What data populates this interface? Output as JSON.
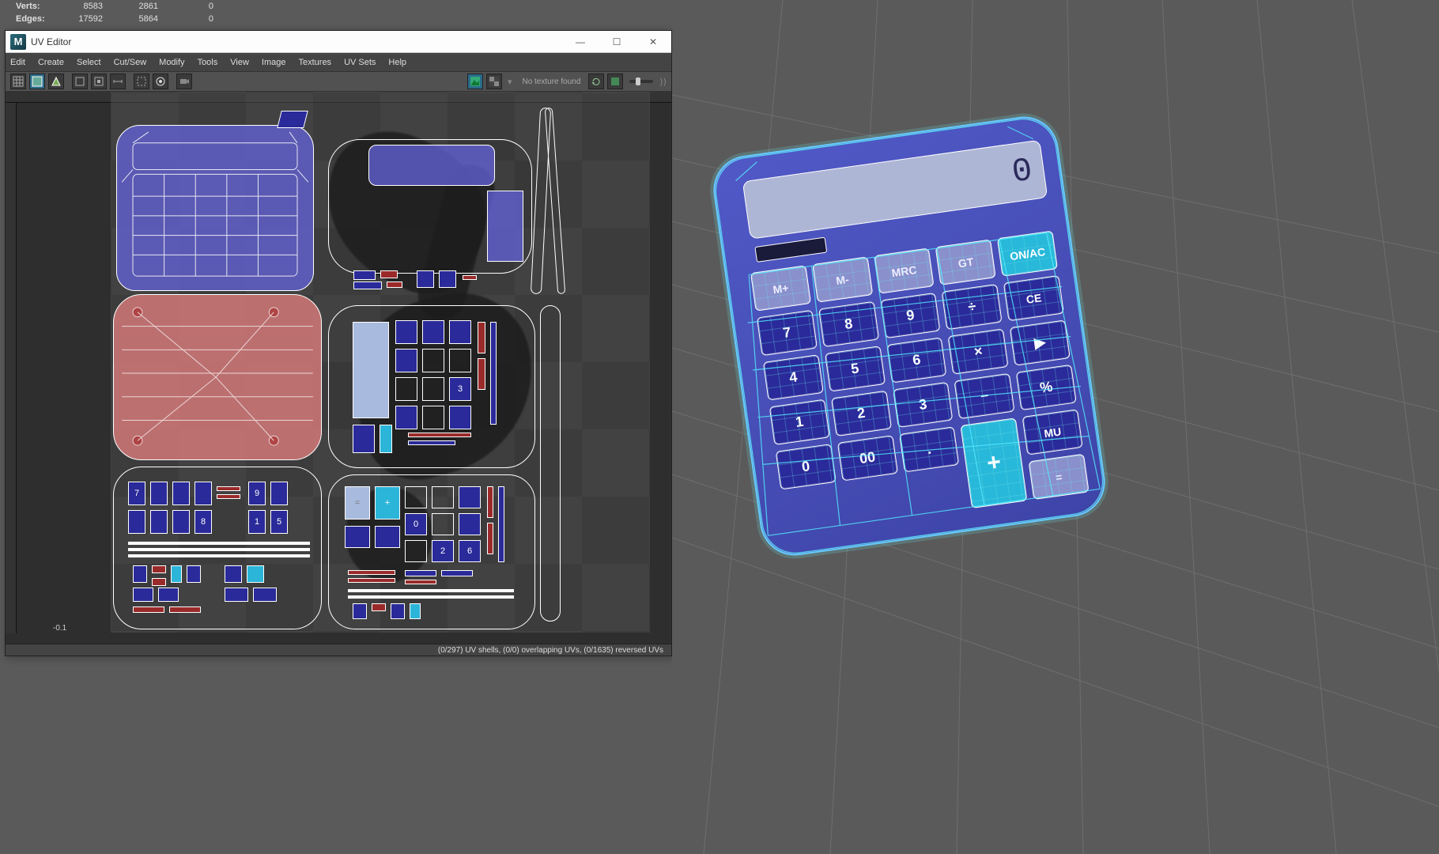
{
  "hud": {
    "rows": [
      {
        "label": "Verts:",
        "a": "8583",
        "b": "2861",
        "c": "0"
      },
      {
        "label": "Edges:",
        "a": "17592",
        "b": "5864",
        "c": "0"
      }
    ]
  },
  "window": {
    "title": "UV Editor",
    "menu": [
      "Edit",
      "Create",
      "Select",
      "Cut/Sew",
      "Modify",
      "Tools",
      "View",
      "Image",
      "Textures",
      "UV Sets",
      "Help"
    ],
    "texture_status": "No texture found",
    "status": "(0/297) UV shells, (0/0) overlapping UVs, (0/1635) reversed UVs",
    "coord": "-0.1"
  },
  "calc": {
    "display": "0",
    "keys": [
      [
        "M+",
        "M-",
        "MRC",
        "GT",
        "ON/AC"
      ],
      [
        "7",
        "8",
        "9",
        "÷",
        "CE"
      ],
      [
        "4",
        "5",
        "6",
        "×",
        "▶"
      ],
      [
        "1",
        "2",
        "3",
        "−",
        "%"
      ],
      [
        "0",
        "00",
        ".",
        "+",
        "MU"
      ],
      [
        "",
        "",
        "",
        "",
        "="
      ]
    ],
    "mem_row_idx": 0,
    "cyan_keys": [
      "ON/AC",
      "+"
    ],
    "eq_key": "="
  },
  "colors": {
    "purple": "#5059c6",
    "cyan": "#28b8da",
    "darkblue": "#2a2a9a"
  }
}
